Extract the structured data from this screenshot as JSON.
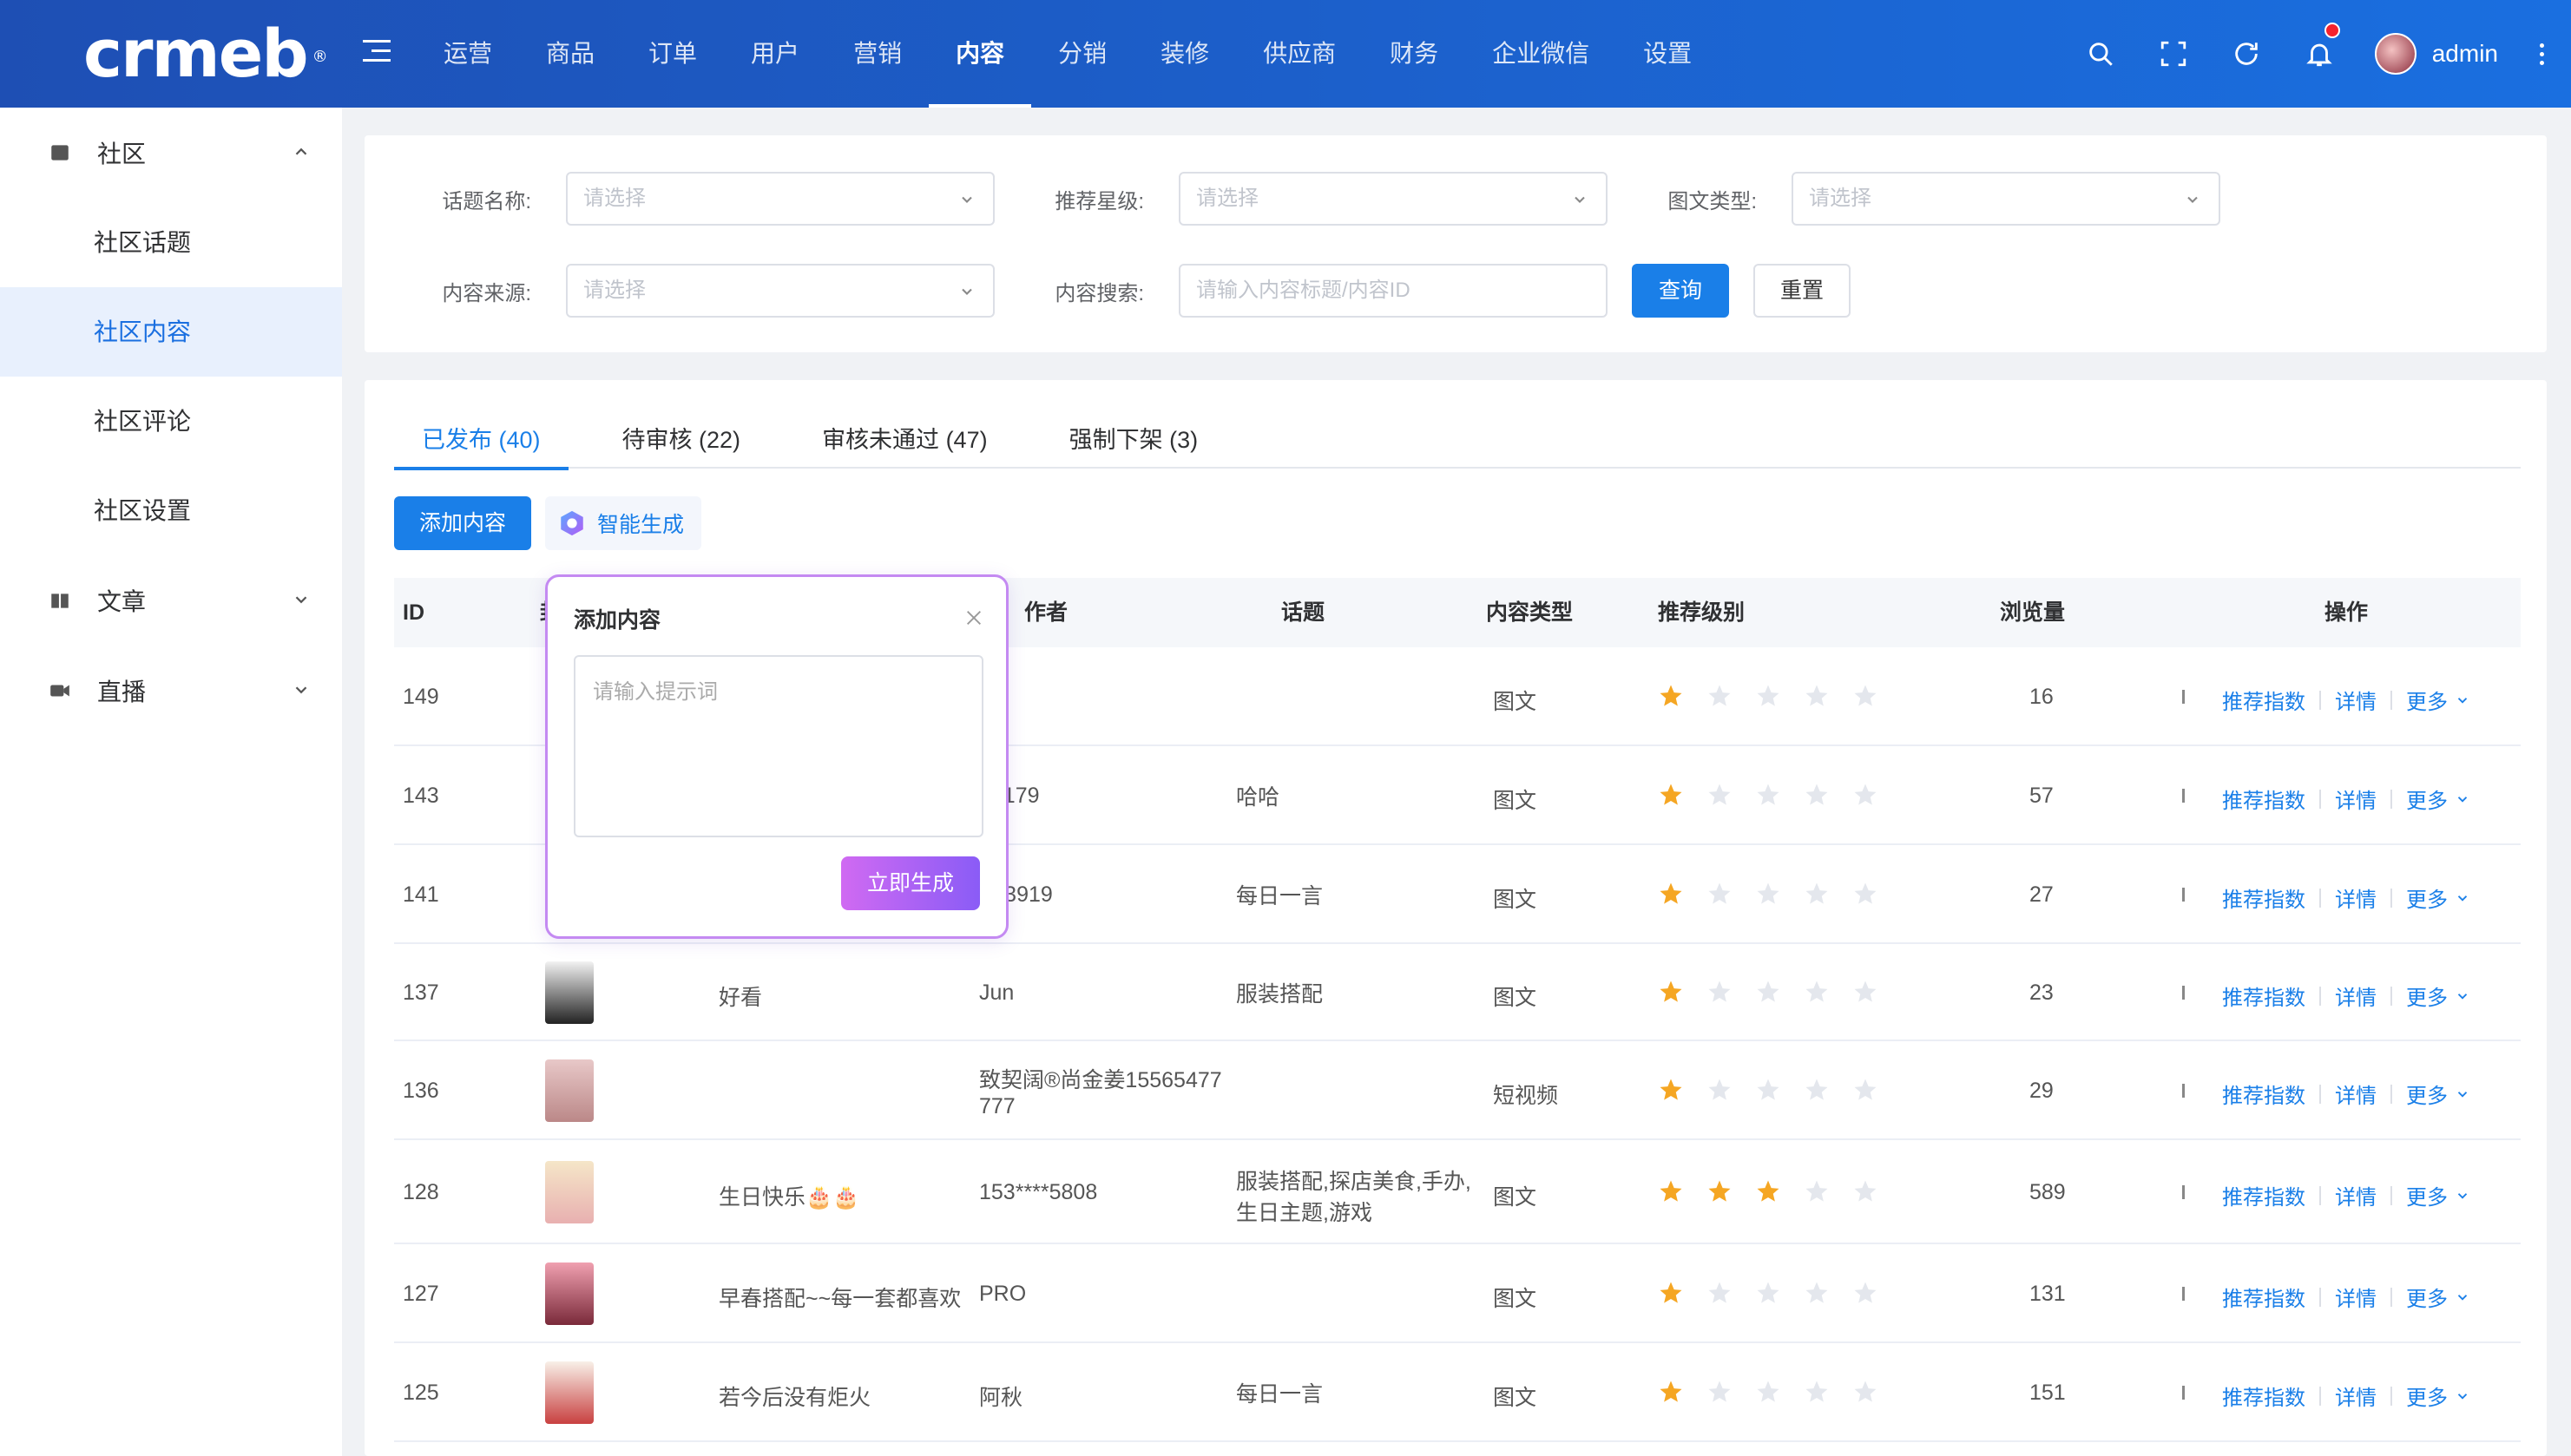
{
  "header": {
    "logo": "crmeb",
    "logo_mark": "®",
    "nav": [
      "运营",
      "商品",
      "订单",
      "用户",
      "营销",
      "内容",
      "分销",
      "装修",
      "供应商",
      "财务",
      "企业微信",
      "设置"
    ],
    "active_nav": "内容",
    "username": "admin"
  },
  "sidebar": {
    "groups": [
      {
        "label": "社区",
        "icon": "community-icon",
        "expanded": true,
        "items": [
          "社区话题",
          "社区内容",
          "社区评论",
          "社区设置"
        ],
        "active": "社区内容"
      },
      {
        "label": "文章",
        "icon": "article-icon",
        "expanded": false
      },
      {
        "label": "直播",
        "icon": "live-icon",
        "expanded": false
      }
    ]
  },
  "filters": {
    "topic_label": "话题名称:",
    "topic_placeholder": "请选择",
    "star_label": "推荐星级:",
    "star_placeholder": "请选择",
    "type_label": "图文类型:",
    "type_placeholder": "请选择",
    "source_label": "内容来源:",
    "source_placeholder": "请选择",
    "search_label": "内容搜索:",
    "search_placeholder": "请输入内容标题/内容ID",
    "query_button": "查询",
    "reset_button": "重置"
  },
  "tabs": [
    {
      "label": "已发布 (40)",
      "active": true
    },
    {
      "label": "待审核 (22)"
    },
    {
      "label": "审核未通过 (47)"
    },
    {
      "label": "强制下架 (3)"
    }
  ],
  "toolbar": {
    "add_button": "添加内容",
    "ai_button": "智能生成"
  },
  "table": {
    "headers": {
      "id": "ID",
      "cover": "封",
      "author": "作者",
      "topic": "话题",
      "type": "内容类型",
      "level": "推荐级别",
      "views": "浏览量",
      "ops": "操作"
    },
    "rows": [
      {
        "id": "149",
        "title": "",
        "author": "",
        "topic": "",
        "type": "图文",
        "stars": 1,
        "views": "16"
      },
      {
        "id": "143",
        "title": "",
        "author": "88179",
        "topic": "哈哈",
        "type": "图文",
        "stars": 1,
        "views": "57"
      },
      {
        "id": "141",
        "title": "",
        "author": "***3919",
        "topic": "每日一言",
        "type": "图文",
        "stars": 1,
        "views": "27"
      },
      {
        "id": "137",
        "title": "好看",
        "author": "Jun",
        "topic": "服装搭配",
        "type": "图文",
        "stars": 1,
        "views": "23"
      },
      {
        "id": "136",
        "title": "",
        "author": "致契阔®尚金姜15565477\n777",
        "author_line1": "致契阔®尚金姜15565477",
        "author_line2": "777",
        "topic": "",
        "type": "短视频",
        "stars": 1,
        "views": "29"
      },
      {
        "id": "128",
        "title": "生日快乐🎂🎂",
        "author": "153****5808",
        "topic_line1": "服装搭配,探店美食,手办,",
        "topic_line2": "生日主题,游戏",
        "type": "图文",
        "stars": 3,
        "views": "589"
      },
      {
        "id": "127",
        "title": "早春搭配~~每一套都喜欢",
        "author": "PRO",
        "topic": "",
        "type": "图文",
        "stars": 1,
        "views": "131"
      },
      {
        "id": "125",
        "title": "若今后没有炬火",
        "author": "阿秋",
        "topic": "每日一言",
        "type": "图文",
        "stars": 1,
        "views": "151"
      }
    ],
    "ops": {
      "recommend": "推荐指数",
      "detail": "详情",
      "more": "更多"
    },
    "max_stars": 5
  },
  "popover": {
    "title": "添加内容",
    "placeholder": "请输入提示词",
    "generate_button": "立即生成"
  },
  "colors": {
    "primary": "#1a7fe8",
    "header_start": "#1e4fb4",
    "header_end": "#1a6fe0",
    "star_on": "#f5a623",
    "star_off": "#e4e7ed",
    "popover_border": "#c48af2"
  }
}
